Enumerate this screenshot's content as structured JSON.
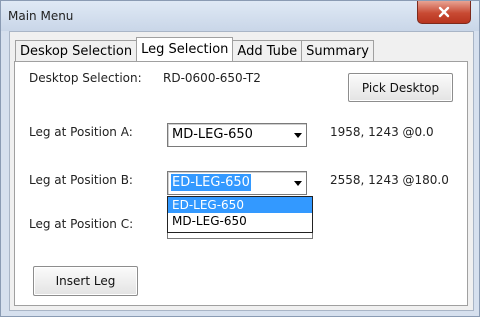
{
  "window": {
    "title": "Main Menu"
  },
  "tabs": [
    {
      "label": "Deskop Selection",
      "active": false
    },
    {
      "label": "Leg Selection",
      "active": true
    },
    {
      "label": "Add Tube",
      "active": false
    },
    {
      "label": "Summary",
      "active": false
    }
  ],
  "desktop": {
    "label": "Desktop Selection:",
    "value": "RD-0600-650-T2",
    "pick_button": "Pick Desktop"
  },
  "legs": [
    {
      "label": "Leg at Position A:",
      "value": "MD-LEG-650",
      "coords": "1958, 1243 @0.0"
    },
    {
      "label": "Leg at Position B:",
      "value": "ED-LEG-650",
      "coords": "2558, 1243 @180.0"
    },
    {
      "label": "Leg at Position C:",
      "value": "",
      "coords": ""
    }
  ],
  "dropdown": {
    "options": [
      "ED-LEG-650",
      "MD-LEG-650"
    ],
    "selected_index": 0
  },
  "insert_button": "Insert Leg",
  "colors": {
    "selection": "#3399ff",
    "close": "#c84a33"
  }
}
